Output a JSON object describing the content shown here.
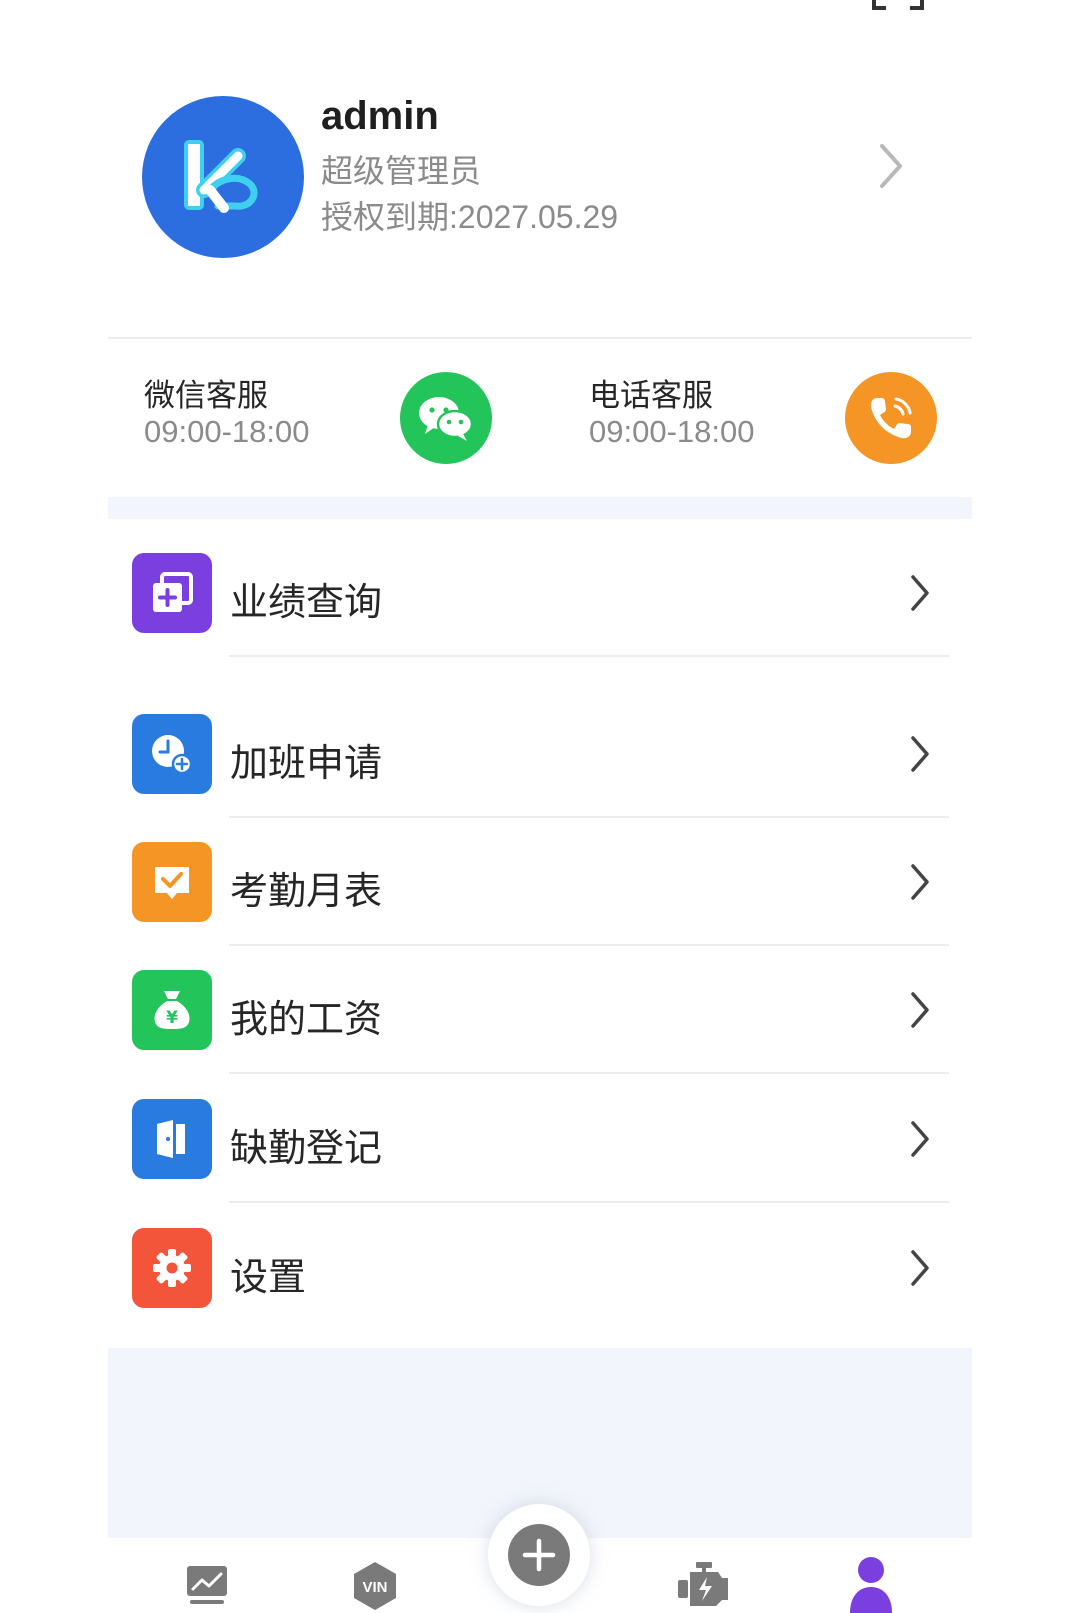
{
  "profile": {
    "username": "admin",
    "role": "超级管理员",
    "license": "授权到期:2027.05.29"
  },
  "support": {
    "wechat": {
      "title": "微信客服",
      "hours": "09:00-18:00",
      "icon": "wechat-icon",
      "color": "#23c45a"
    },
    "phone": {
      "title": "电话客服",
      "hours": "09:00-18:00",
      "icon": "phone-icon",
      "color": "#f59526"
    }
  },
  "menu": [
    {
      "label": "业绩查询",
      "icon": "performance-icon",
      "color": "#7b3fe0"
    },
    {
      "label": "加班申请",
      "icon": "overtime-clock-icon",
      "color": "#2a7be0"
    },
    {
      "label": "考勤月表",
      "icon": "attendance-icon",
      "color": "#f59526"
    },
    {
      "label": "我的工资",
      "icon": "salary-bag-icon",
      "color": "#23c45a"
    },
    {
      "label": "缺勤登记",
      "icon": "absence-door-icon",
      "color": "#2a7be0"
    },
    {
      "label": "设置",
      "icon": "settings-gear-icon",
      "color": "#f2553a"
    }
  ],
  "tabbar": {
    "vin_text": "VIN",
    "active_color": "#7b3fe0",
    "items": [
      "chart-icon",
      "vin-icon",
      "add-icon",
      "engine-icon",
      "profile-icon"
    ]
  }
}
